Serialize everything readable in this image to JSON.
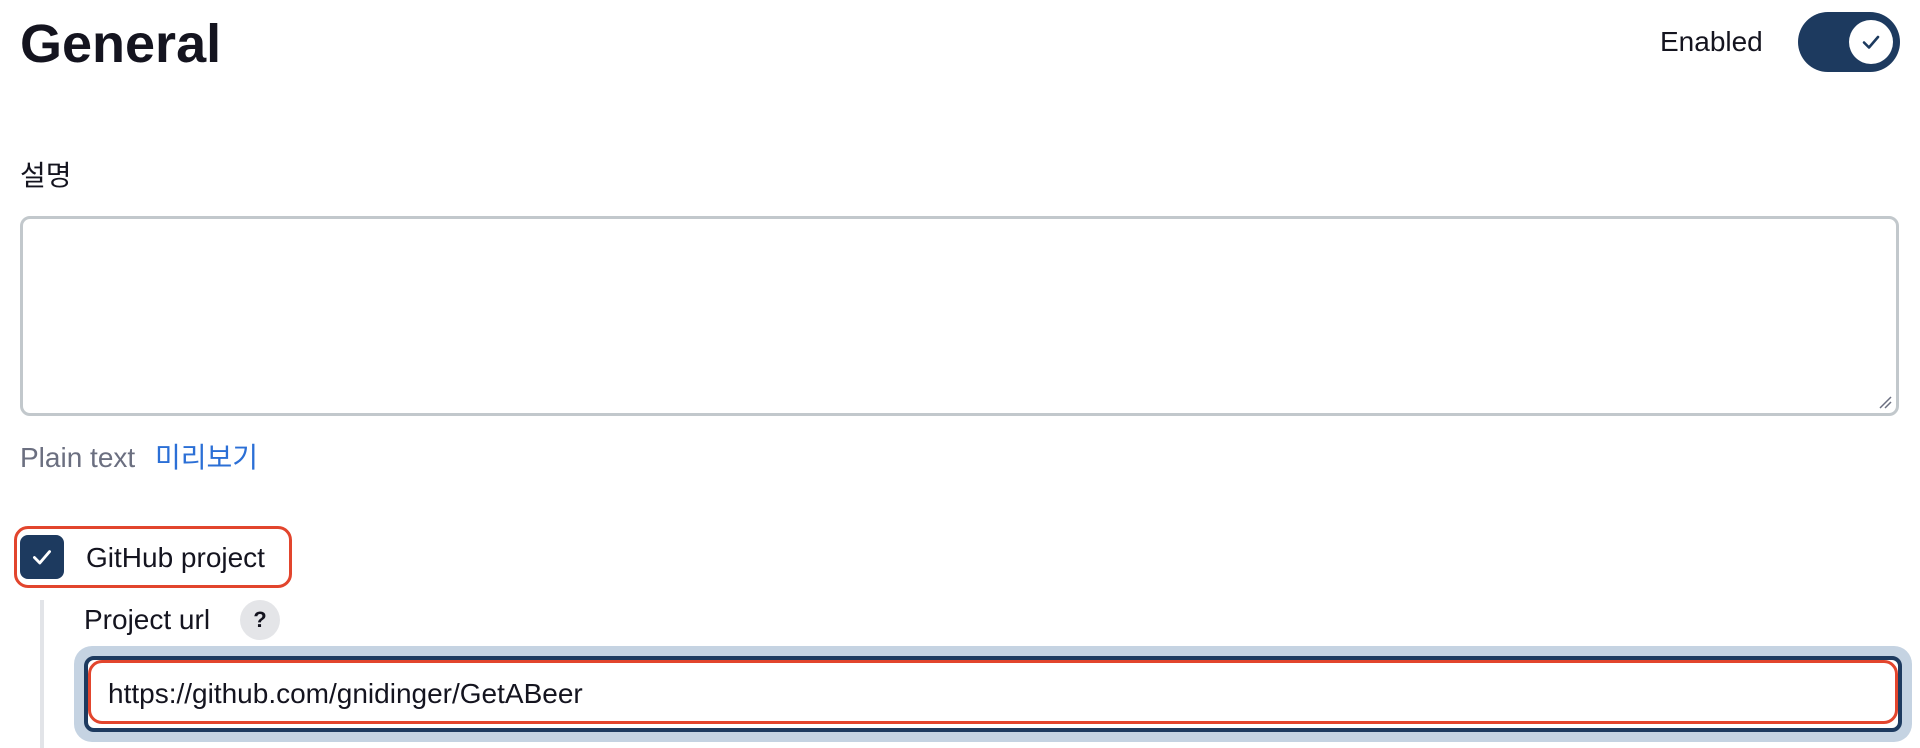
{
  "header": {
    "title": "General",
    "enabled_label": "Enabled",
    "enabled": true
  },
  "description": {
    "label": "설명",
    "value": "",
    "format_label": "Plain text",
    "preview_link": "미리보기"
  },
  "github_project": {
    "checkbox_label": "GitHub project",
    "checked": true,
    "project_url_label": "Project url",
    "help_label": "?",
    "project_url_value": "https://github.com/gnidinger/GetABeer"
  },
  "icons": {
    "toggle_check": "check-icon",
    "checkbox_check": "check-icon",
    "resize": "resize-grip-icon"
  },
  "colors": {
    "accent": "#1d3a5f",
    "link": "#2b6fd6",
    "highlight": "#e2452d",
    "focus_ring": "#c5d3e2"
  }
}
